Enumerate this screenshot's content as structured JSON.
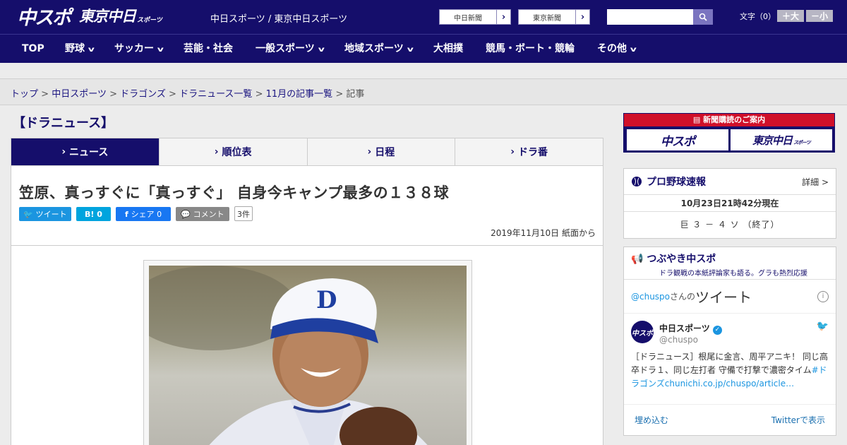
{
  "header": {
    "logo_chuspo": "中スポ",
    "logo_tokyo": "東京中日",
    "logo_tokyo_sub": "スポーツ",
    "site_line": "中日スポーツ / 東京中日スポーツ",
    "partner1": "中日新聞",
    "partner2": "東京新聞",
    "search_placeholder": "",
    "font_label": "文字（0）",
    "font_plus": "＋大",
    "font_minus": "－小"
  },
  "nav": [
    {
      "label": "TOP",
      "dropdown": false
    },
    {
      "label": "野球",
      "dropdown": true
    },
    {
      "label": "サッカー",
      "dropdown": true
    },
    {
      "label": "芸能・社会",
      "dropdown": false
    },
    {
      "label": "一般スポーツ",
      "dropdown": true
    },
    {
      "label": "地域スポーツ",
      "dropdown": true
    },
    {
      "label": "大相撲",
      "dropdown": false
    },
    {
      "label": "競馬・ボート・競輪",
      "dropdown": false
    },
    {
      "label": "その他",
      "dropdown": true
    }
  ],
  "breadcrumb": {
    "items": [
      "トップ",
      "中日スポーツ",
      "ドラゴンズ",
      "ドラニュース一覧",
      "11月の記事一覧"
    ],
    "current": "記事",
    "sep": ">"
  },
  "category_title": "【ドラニュース】",
  "tabs": [
    {
      "label": "ニュース",
      "active": true
    },
    {
      "label": "順位表",
      "active": false
    },
    {
      "label": "日程",
      "active": false
    },
    {
      "label": "ドラ番",
      "active": false
    }
  ],
  "article": {
    "title": "笠原、真っすぐに「真っすぐ」 自身今キャンプ最多の１３８球",
    "tweet_label": "ツイート",
    "hatena_label": "B!",
    "hatena_count": "0",
    "share_label": "シェア",
    "share_count": "0",
    "comment_label": "コメント",
    "comment_count": "3件",
    "date": "2019年11月10日 紙面から"
  },
  "sidebar": {
    "subscribe_title": "新聞購読のご案内",
    "subscribe_chuspo": "中スポ",
    "subscribe_tokyo": "東京中日",
    "subscribe_tokyo_sub": "スポーツ",
    "pro_title": "プロ野球速報",
    "pro_more": "詳細 >",
    "pro_time": "10月23日21時42分現在",
    "pro_score": "巨 ３ － ４ ソ （終了）",
    "tw_title": "つぶやき中スポ",
    "tw_sub": "ドラ観戦の本紙評論家も語る。グラも熱烈応援",
    "tw_handle": "@chuspo",
    "tw_san": "さんの",
    "tw_big": "ツイート",
    "tw_name": "中日スポーツ",
    "tw_id": "@chuspo",
    "tw_avatar": "中スポ",
    "tw_text": "［ドラニュース］根尾に金言、周平アニキ！ 同じ高卒ドラ１、同じ左打者 守備で打撃で濃密タイム",
    "tw_link": "#ドラゴンズchunichi.co.jp/chuspo/article…",
    "tw_embed": "埋め込む",
    "tw_view": "Twitterで表示"
  },
  "colors": {
    "brand": "#150e6b",
    "accent": "#d0102a",
    "twitter": "#1b95e0",
    "facebook": "#1877f2",
    "hatena": "#00a4de"
  }
}
